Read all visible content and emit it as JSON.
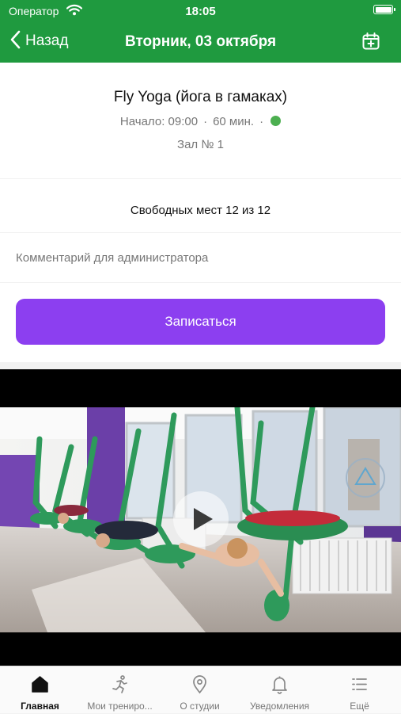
{
  "status_bar": {
    "carrier": "Оператор",
    "time": "18:05"
  },
  "nav": {
    "back_label": "Назад",
    "title": "Вторник, 03 октября"
  },
  "class": {
    "title": "Fly Yoga (йога в гамаках)",
    "start": "Начало: 09:00",
    "duration": "60 мин.",
    "room": "Зал № 1",
    "status_color": "#4caf50"
  },
  "spots": {
    "text": "Свободных мест 12 из 12"
  },
  "comment": {
    "placeholder": "Комментарий для администратора",
    "value": ""
  },
  "signup": {
    "label": "Записаться"
  },
  "colors": {
    "header": "#1f9a3f",
    "accent": "#8c3ff0"
  },
  "tabs": [
    {
      "label": "Главная",
      "icon": "home-icon",
      "active": true
    },
    {
      "label": "Мои трениро...",
      "icon": "running-person-icon",
      "active": false
    },
    {
      "label": "О студии",
      "icon": "map-pin-icon",
      "active": false
    },
    {
      "label": "Уведомления",
      "icon": "bell-icon",
      "active": false
    },
    {
      "label": "Ещё",
      "icon": "menu-list-icon",
      "active": false
    }
  ]
}
